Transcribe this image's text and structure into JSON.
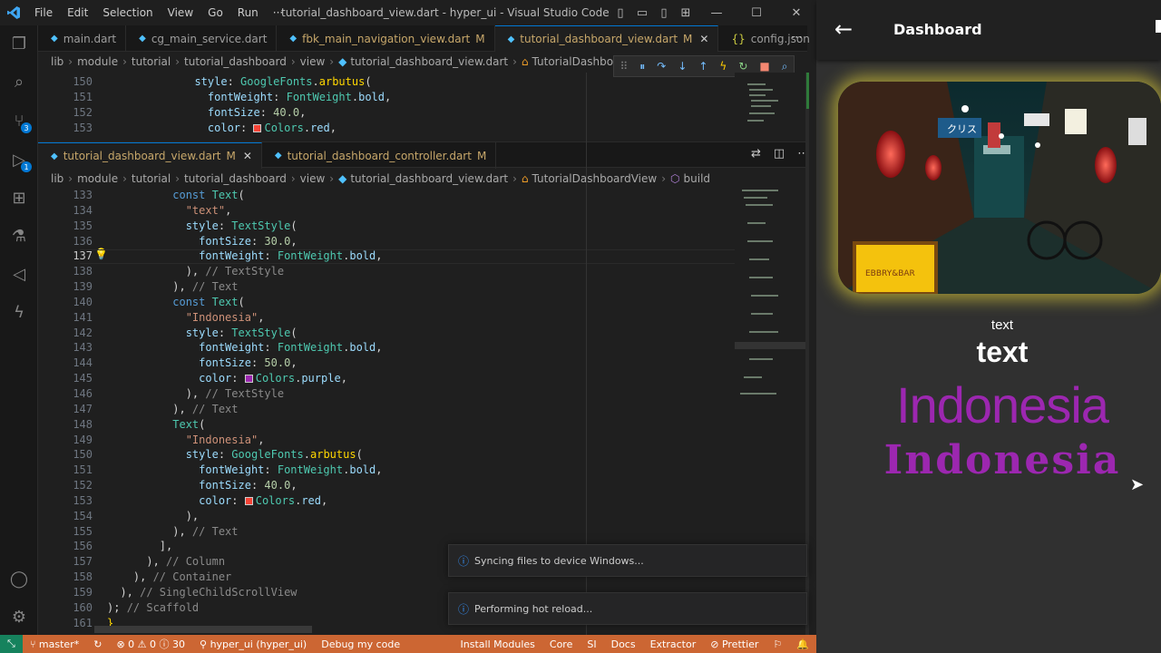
{
  "menu": [
    "File",
    "Edit",
    "Selection",
    "View",
    "Go",
    "Run",
    "···"
  ],
  "window_title": "tutorial_dashboard_view.dart - hyper_ui - Visual Studio Code",
  "top_tabs": [
    {
      "label": "main.dart",
      "m": "",
      "active": false
    },
    {
      "label": "cg_main_service.dart",
      "m": "",
      "active": false
    },
    {
      "label": "fbk_main_navigation_view.dart",
      "m": "M",
      "active": false
    },
    {
      "label": "tutorial_dashboard_view.dart",
      "m": "M",
      "active": true
    },
    {
      "label": "config.json",
      "m": "",
      "active": false
    }
  ],
  "crumbs_top": [
    "lib",
    "module",
    "tutorial",
    "tutorial_dashboard",
    "view",
    "tutorial_dashboard_view.dart",
    "TutorialDashboardView"
  ],
  "bottom_tabs": [
    {
      "label": "tutorial_dashboard_view.dart",
      "m": "M",
      "active": true
    },
    {
      "label": "tutorial_dashboard_controller.dart",
      "m": "M",
      "active": false
    }
  ],
  "crumbs_bottom": [
    "lib",
    "module",
    "tutorial",
    "tutorial_dashboard",
    "view",
    "tutorial_dashboard_view.dart",
    "TutorialDashboardView",
    "build"
  ],
  "top_lines": [
    "150",
    "151",
    "152",
    "153"
  ],
  "bottom_lines": [
    "133",
    "134",
    "135",
    "136",
    "137",
    "138",
    "139",
    "140",
    "141",
    "142",
    "143",
    "144",
    "145",
    "146",
    "147",
    "148",
    "149",
    "150",
    "151",
    "152",
    "153",
    "154",
    "155",
    "156",
    "157",
    "158",
    "159",
    "160",
    "161"
  ],
  "toasts": [
    "Syncing files to device Windows...",
    "Performing hot reload..."
  ],
  "status": {
    "branch": "master*",
    "errors": "0",
    "warnings": "0",
    "info": "30",
    "project": "hyper_ui (hyper_ui)",
    "debug": "Debug my code",
    "install": "Install Modules",
    "core": "Core",
    "si": "SI",
    "docs": "Docs",
    "extractor": "Extractor",
    "prettier": "Prettier"
  },
  "app": {
    "title": "Dashboard",
    "text_small": "text",
    "text_big": "text",
    "indo1": "Indonesia",
    "indo2": "Indonesia",
    "colors": {
      "purple": "#9c27b0",
      "appbar": "#212121",
      "glow": "#ffeb3b"
    }
  },
  "sign_text": "EBBRY&BAR",
  "neon": "クリス"
}
